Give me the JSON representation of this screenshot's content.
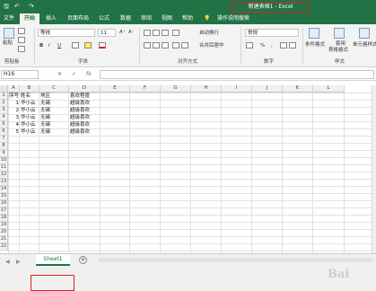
{
  "titlebar": {
    "title": "新建表格1 - Excel"
  },
  "tabs": [
    "文件",
    "开始",
    "插入",
    "页面布局",
    "公式",
    "数据",
    "审阅",
    "视图",
    "帮助",
    "操作说明搜索"
  ],
  "ribbon": {
    "paste": "粘贴",
    "font_name": "等线",
    "font_size": "11",
    "bold": "B",
    "italic": "I",
    "underline": "U",
    "wrap_text": "自动换行",
    "merge_center": "合并后居中",
    "number_format": "常规",
    "percent": "%",
    "comma": ",",
    "cond_format": "条件格式",
    "table_format_1": "套用",
    "table_format_2": "表格格式",
    "cell_style": "单元格样式",
    "groups": {
      "clipboard": "剪贴板",
      "font": "字体",
      "alignment": "对齐方式",
      "number": "数字",
      "styles": "样式"
    }
  },
  "formula_bar": {
    "name_box": "H16",
    "cancel": "✕",
    "confirm": "✓",
    "fx": "fx"
  },
  "grid": {
    "columns": [
      "A",
      "B",
      "C",
      "D",
      "E",
      "F",
      "G",
      "H",
      "I",
      "J",
      "K",
      "L"
    ],
    "rows": [
      "1",
      "2",
      "3",
      "4",
      "5",
      "6",
      "7",
      "8",
      "9",
      "10",
      "11",
      "12",
      "13",
      "14",
      "15",
      "16",
      "17",
      "18",
      "19",
      "20",
      "21",
      "22"
    ],
    "header_row": [
      "序号",
      "姓名",
      "地区",
      "喜欢程度"
    ],
    "data": [
      [
        "1",
        "华小云",
        "无锡",
        "超级喜欢"
      ],
      [
        "2",
        "华小云",
        "无锡",
        "超级喜欢"
      ],
      [
        "3",
        "华小云",
        "无锡",
        "超级喜欢"
      ],
      [
        "4",
        "华小云",
        "无锡",
        "超级喜欢"
      ],
      [
        "5",
        "华小云",
        "无锡",
        "超级喜欢"
      ]
    ]
  },
  "sheets": {
    "active": "Sheet1",
    "add": "+"
  },
  "watermark": "Bai"
}
